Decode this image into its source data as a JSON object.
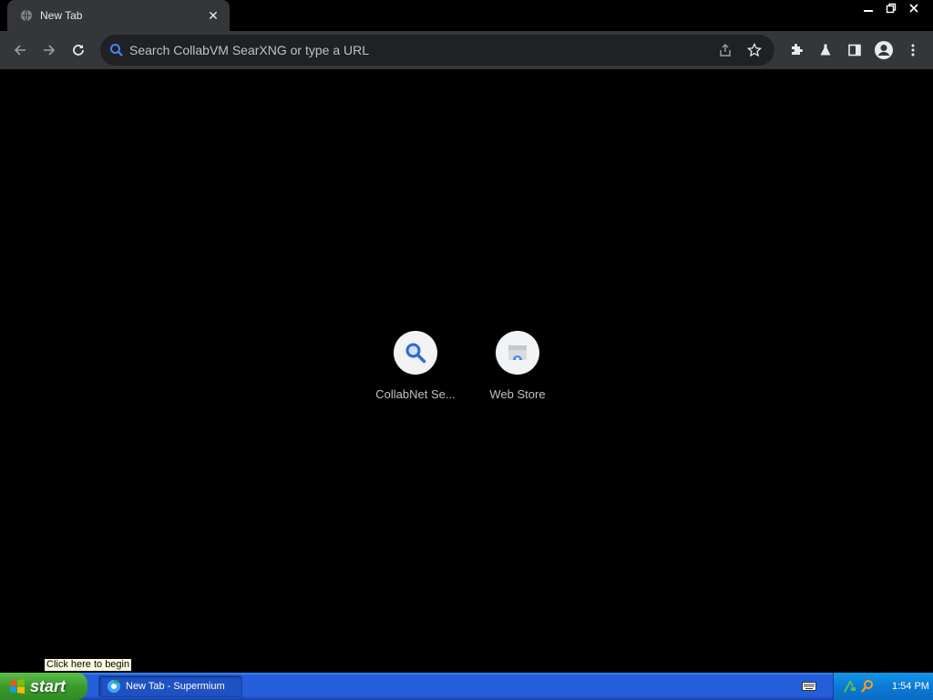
{
  "browser": {
    "tab": {
      "title": "New Tab",
      "close_symbol": "✕"
    },
    "omnibox": {
      "placeholder": "Search CollabVM SearXNG or type a URL"
    }
  },
  "new_tab_page": {
    "shortcuts": [
      {
        "label": "CollabNet Se...",
        "icon": "magnifier-icon"
      },
      {
        "label": "Web Store",
        "icon": "web-store-icon"
      }
    ]
  },
  "tooltip": {
    "text": "Click here to begin"
  },
  "taskbar": {
    "start_label": "start",
    "task_items": [
      {
        "label": "New Tab - Supermium"
      }
    ],
    "clock": "1:54 PM"
  },
  "colors": {
    "toolbar_bg": "#35363a",
    "omnibox_bg": "#202124",
    "accent_blue": "#4285f4",
    "taskbar_blue": "#245edb",
    "start_green": "#3c9a2e"
  }
}
